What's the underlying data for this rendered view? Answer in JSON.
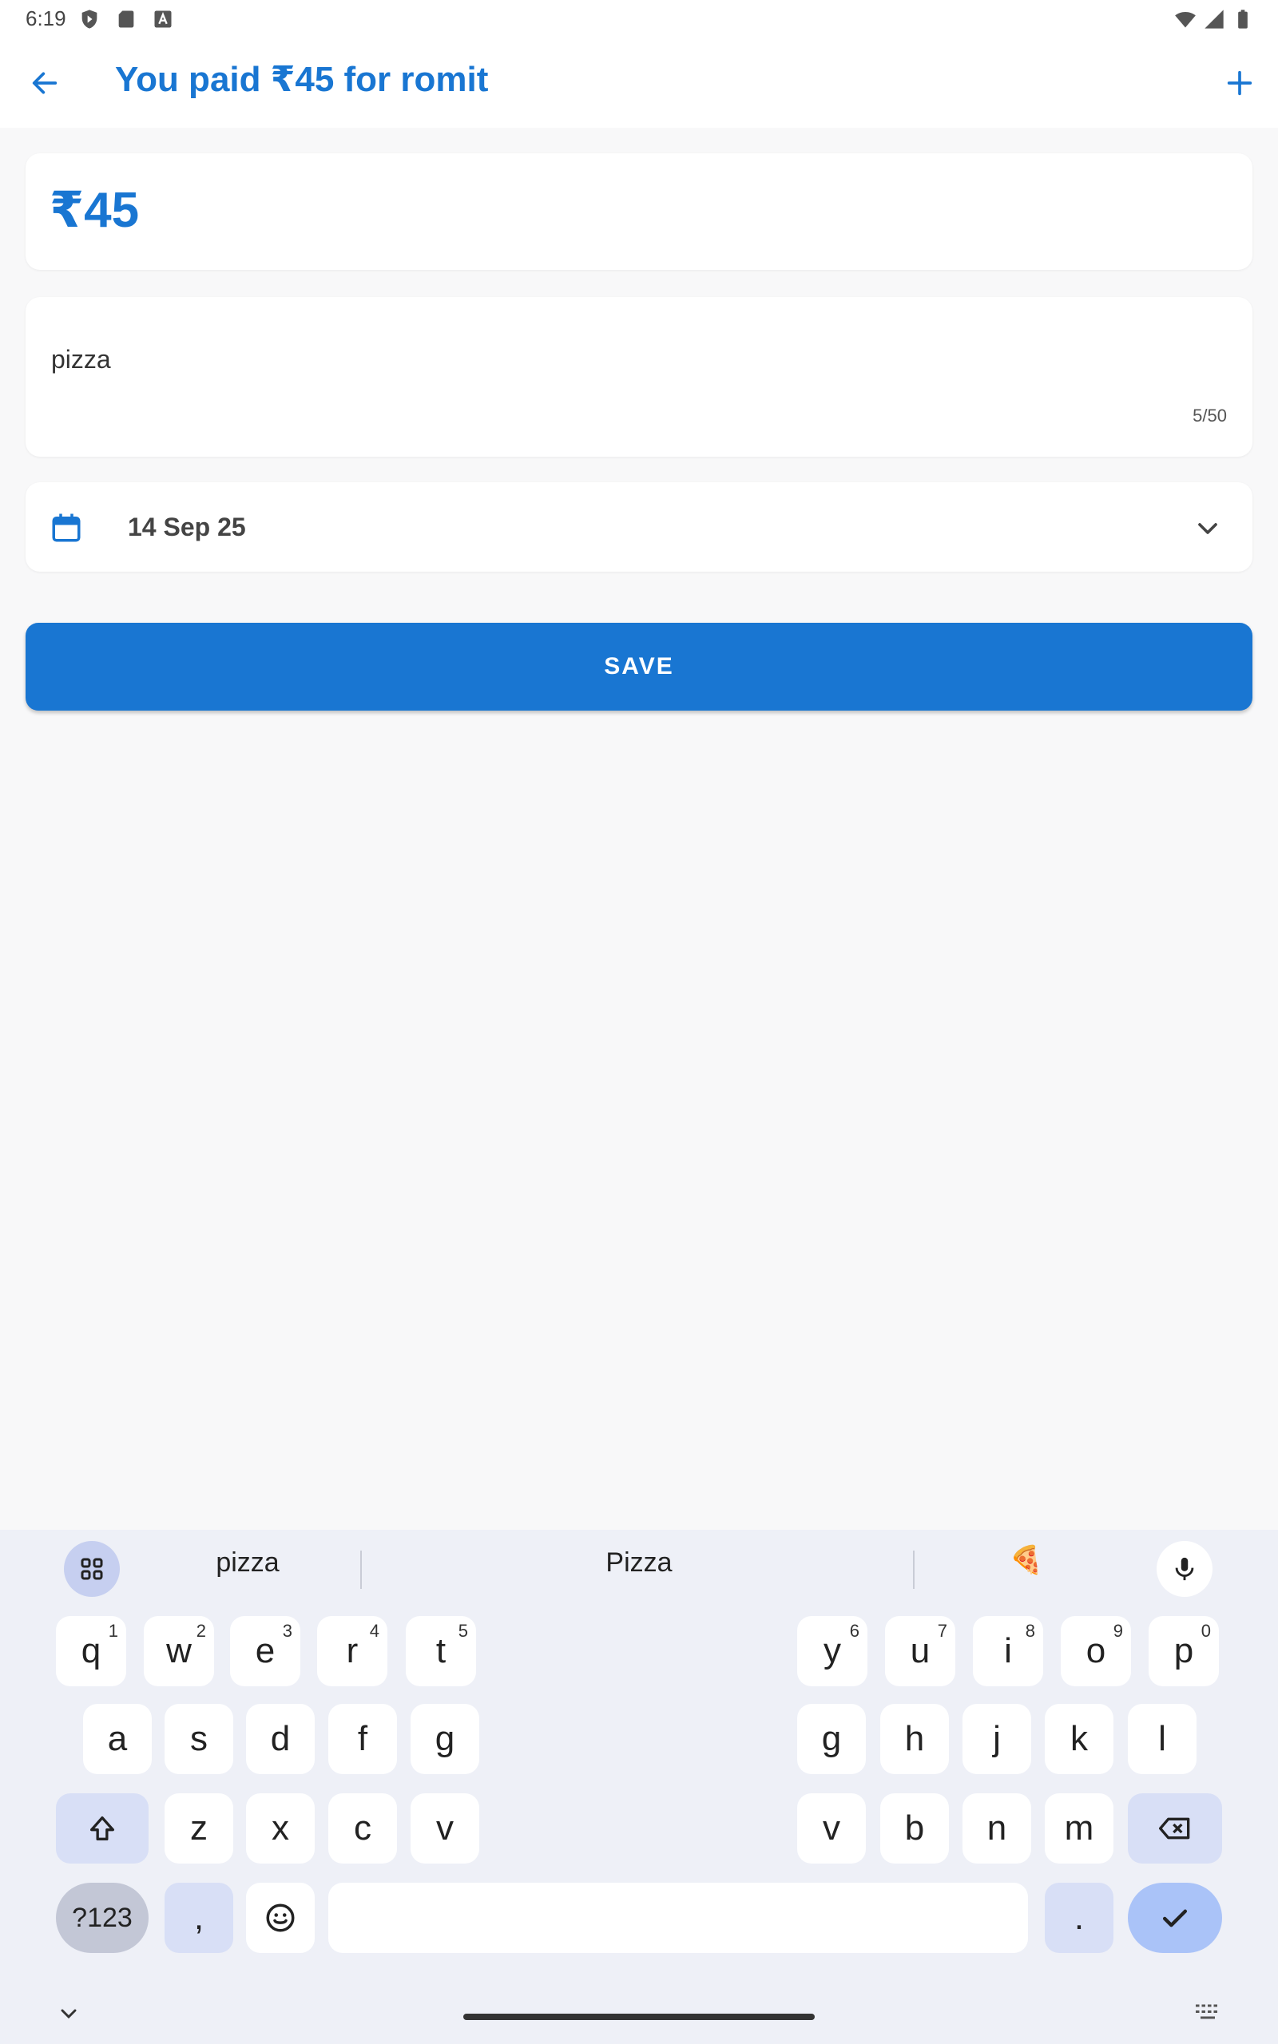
{
  "status_bar": {
    "time": "6:19",
    "icons": [
      "shield-icon",
      "sd-card-icon",
      "keyboard-a-icon",
      "wifi-icon",
      "signal-icon",
      "battery-icon"
    ]
  },
  "app_bar": {
    "title": "You paid ₹45 for romit",
    "back_icon": "arrow-back-icon",
    "add_icon": "plus-icon"
  },
  "amount": {
    "value": "₹45"
  },
  "note": {
    "value": "pizza",
    "counter": "5/50"
  },
  "date": {
    "value": "14 Sep 25",
    "icon": "calendar-icon"
  },
  "save_label": "SAVE",
  "colors": {
    "accent": "#1976d2",
    "background": "#f8f8f9",
    "keyboard": "#eef0f7"
  },
  "keyboard": {
    "suggestions": [
      "pizza",
      "Pizza",
      "🍕"
    ],
    "row1_left": [
      {
        "k": "q",
        "h": "1"
      },
      {
        "k": "w",
        "h": "2"
      },
      {
        "k": "e",
        "h": "3"
      },
      {
        "k": "r",
        "h": "4"
      },
      {
        "k": "t",
        "h": "5"
      }
    ],
    "row1_right": [
      {
        "k": "y",
        "h": "6"
      },
      {
        "k": "u",
        "h": "7"
      },
      {
        "k": "i",
        "h": "8"
      },
      {
        "k": "o",
        "h": "9"
      },
      {
        "k": "p",
        "h": "0"
      }
    ],
    "row2_left": [
      "a",
      "s",
      "d",
      "f",
      "g"
    ],
    "row2_right": [
      "g",
      "h",
      "j",
      "k",
      "l"
    ],
    "row3_left": [
      "z",
      "x",
      "c",
      "v"
    ],
    "row3_right": [
      "v",
      "b",
      "n",
      "m"
    ],
    "symbols_label": "?123",
    "comma_label": ",",
    "period_label": "."
  }
}
